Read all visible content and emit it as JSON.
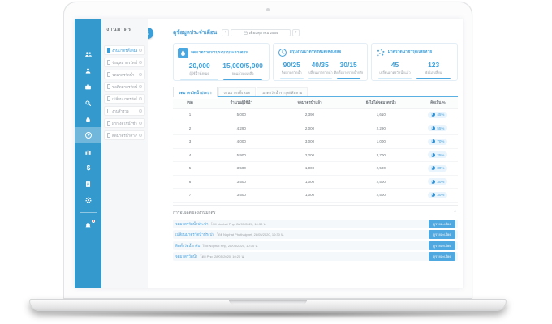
{
  "app": {
    "nav_title": "งานมาตร",
    "sidebar_icons": [
      "team",
      "user",
      "briefcase",
      "search",
      "water-drop",
      "meter",
      "chart",
      "money",
      "document",
      "settings",
      "bell"
    ],
    "active_icon": "meter",
    "menu_items": [
      {
        "label": "งานมาตรทั้งหมด",
        "active": true
      },
      {
        "label": "ข้อมูลมาตรวัดน้ำ",
        "active": false
      },
      {
        "label": "จดมาตรวัดน้ำ",
        "active": false
      },
      {
        "label": "ขอติดมาตรวัดน้ำใหม่",
        "active": false
      },
      {
        "label": "เปลี่ยนมาตรวัดน้ำ",
        "active": false
      },
      {
        "label": "งานสำรวจ",
        "active": false
      },
      {
        "label": "ฝาก/งดใช้น้ำชั่วคราว",
        "active": false
      },
      {
        "label": "ตัดมาตรน้ำค้างชำระ/ถาวร",
        "active": false
      }
    ],
    "header": {
      "title": "ดูข้อมูลประจำเดือน",
      "prev_label": "‹",
      "next_label": "›",
      "month_selector": "เดือนตุลาคม 2564"
    },
    "cards": [
      {
        "icon": "water-drop",
        "title": "จดมาตรวัดน้ำประปาประจำเดือน",
        "stats": [
          {
            "value": "20,000",
            "label": "ผู้ใช้น้ำทั้งหมด",
            "bar": "light"
          },
          {
            "value": "15,000/5,000",
            "label": "จดแล้ว/คงเหลือ",
            "bar": "solid"
          }
        ]
      },
      {
        "icon": "clock",
        "title": "สรุปงานมาตรทั้งหมด/คงเหลือ",
        "stats": [
          {
            "value": "90/25",
            "label": "ติดมาตรวัดน้ำ",
            "bar": "light"
          },
          {
            "value": "40/35",
            "label": "เปลี่ยนมาตรวัดน้ำ",
            "bar": "light"
          },
          {
            "value": "30/15",
            "label": "ติดตั้งมาตรวัดน้ำกลับ",
            "bar": "solid"
          }
        ]
      },
      {
        "icon": "dots",
        "title": "มาตรวัดน้ำชำรุด/เสียหาย",
        "stats": [
          {
            "value": "45",
            "label": "เปลี่ยนมาตรวัดน้ำแล้ว",
            "bar": "light"
          },
          {
            "value": "123",
            "label": "ยังไม่เปลี่ยน",
            "bar": "solid"
          }
        ]
      }
    ],
    "tabs": [
      {
        "label": "จดมาตรวัดน้ำประปา",
        "active": true
      },
      {
        "label": "งานมาตรทั้งหมด",
        "active": false
      },
      {
        "label": "มาตรวัดน้ำชำรุด/เสียหาย",
        "active": false
      }
    ],
    "table": {
      "headers": [
        "เขต",
        "จำนวนผู้ใช้น้ำ",
        "จดมาตรน้ำแล้ว",
        "ยังไม่ได้จดมาตรน้ำ",
        "คิดเป็น %"
      ],
      "rows": [
        {
          "zone": "1",
          "users": "5,000",
          "recorded": "2,390",
          "remaining": "1,610",
          "percent": "45%"
        },
        {
          "zone": "2",
          "users": "4,290",
          "recorded": "2,000",
          "remaining": "2,290",
          "percent": "55%"
        },
        {
          "zone": "3",
          "users": "4,000",
          "recorded": "3,000",
          "remaining": "1,000",
          "percent": "70%"
        },
        {
          "zone": "4",
          "users": "5,900",
          "recorded": "2,200",
          "remaining": "3,700",
          "percent": "25%"
        },
        {
          "zone": "5",
          "users": "3,500",
          "recorded": "1,000",
          "remaining": "2,500",
          "percent": "30%"
        },
        {
          "zone": "6",
          "users": "3,500",
          "recorded": "1,000",
          "remaining": "2,500",
          "percent": "30%"
        },
        {
          "zone": "7",
          "users": "3,500",
          "recorded": "1,000",
          "remaining": "2,500",
          "percent": "30%"
        }
      ]
    },
    "updates": {
      "title": "การอัปเดตของงานมาตร",
      "button_label": "ดูรายละเอียด",
      "items": [
        {
          "title": "จดมาตรวัดน้ำประปา",
          "meta": "โดย Nophat Php, 28/05/2020, 10:30 น."
        },
        {
          "title": "เปลี่ยนมาตรวัดน้ำประปา",
          "meta": "โดย Nophat Phuthaiphet, 28/05/2020, 10:30 น."
        },
        {
          "title": "ติดตั้งวัดน้ำกลับ",
          "meta": "โดย Nophat Php, 28/05/2020, 10:30 น."
        },
        {
          "title": "จดมาตรวัดน้ำ",
          "meta": "โดย Php, 28/05/2020, 10:20 น."
        }
      ]
    },
    "colors": {
      "sidebar_blue": "#3499cd",
      "accent_blue": "#4aa7e0",
      "value_blue": "#3ea1da",
      "badge_bg": "#e9f4fc",
      "notification_red": "#e95d5d"
    }
  }
}
